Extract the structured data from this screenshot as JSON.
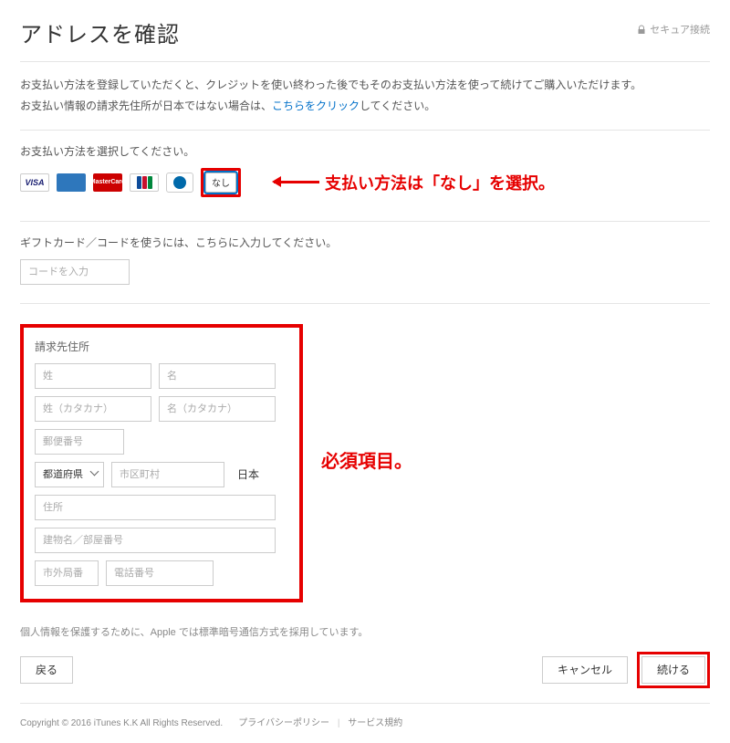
{
  "header": {
    "title": "アドレスを確認",
    "secure": "セキュア接続"
  },
  "intro": {
    "line1": "お支払い方法を登録していただくと、クレジットを使い終わった後でもそのお支払い方法を使って続けてご購入いただけます。",
    "line2a": "お支払い情報の請求先住所が日本ではない場合は、",
    "link": "こちらをクリック",
    "line2b": "してください。"
  },
  "payment": {
    "label": "お支払い方法を選択してください。",
    "none_label": "なし",
    "annotation": "支払い方法は「なし」を選択。"
  },
  "gift": {
    "label": "ギフトカード／コードを使うには、こちらに入力してください。",
    "placeholder": "コードを入力"
  },
  "address": {
    "title": "請求先住所",
    "last": "姓",
    "first": "名",
    "last_kana": "姓（カタカナ）",
    "first_kana": "名（カタカナ）",
    "postal": "郵便番号",
    "pref": "都道府県",
    "city": "市区町村",
    "country": "日本",
    "street": "住所",
    "bldg": "建物名／部屋番号",
    "area": "市外局番",
    "phone": "電話番号",
    "annotation": "必須項目。"
  },
  "privacy": "個人情報を保護するために、Apple では標準暗号通信方式を採用しています。",
  "buttons": {
    "back": "戻る",
    "cancel": "キャンセル",
    "continue": "続ける"
  },
  "footer": {
    "copyright": "Copyright © 2016 iTunes K.K All Rights Reserved.",
    "privacy": "プライバシーポリシー",
    "terms": "サービス規約"
  }
}
